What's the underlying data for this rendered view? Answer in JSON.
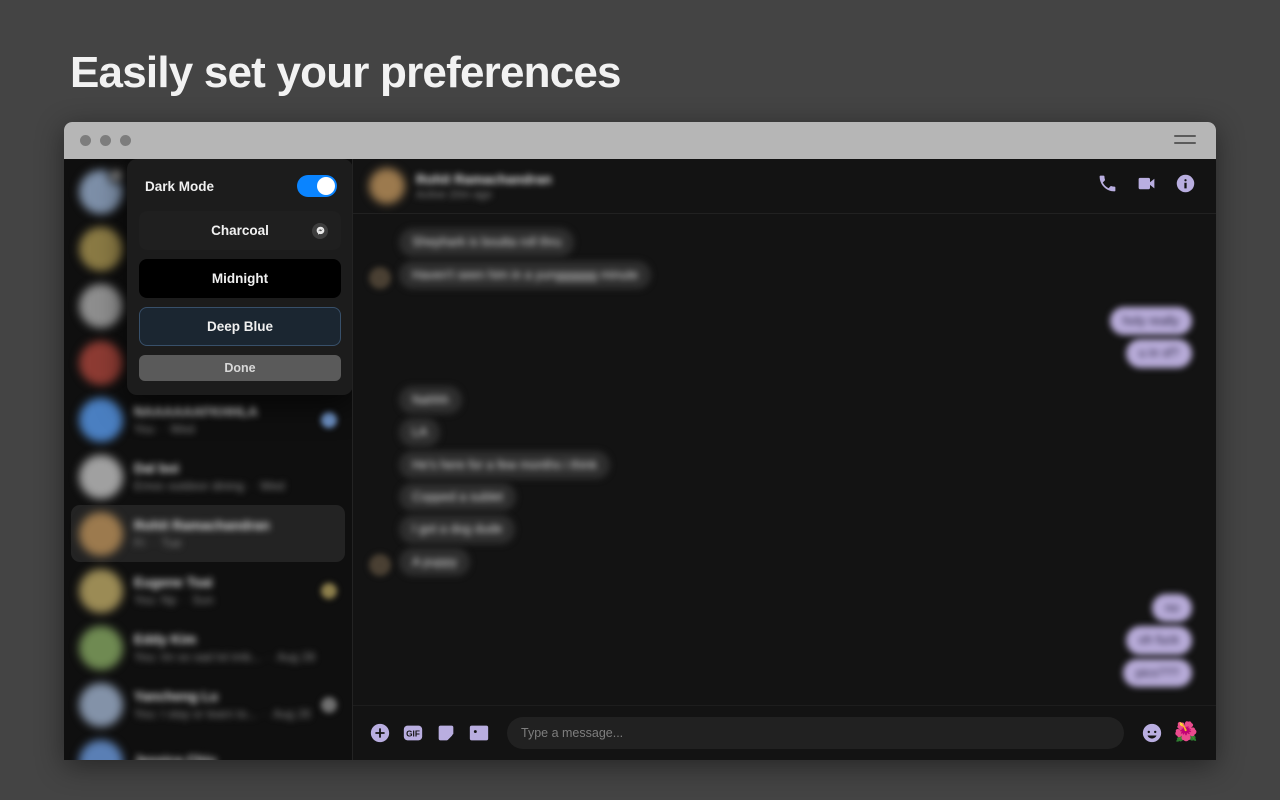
{
  "headline": "Easily set your preferences",
  "window": {
    "titlebar": {
      "dots": [
        "close-dot",
        "minimize-dot",
        "maximize-dot"
      ],
      "menu_icon": "hamburger-menu-icon"
    }
  },
  "dialog": {
    "title": "Dark Mode",
    "toggle": {
      "state": "on",
      "color": "#0a84ff"
    },
    "options": [
      {
        "label": "Charcoal",
        "selected": true,
        "swatch": "#1f1f1f",
        "badge_icon": "messenger-icon"
      },
      {
        "label": "Midnight",
        "selected": false,
        "swatch": "#000000"
      },
      {
        "label": "Deep Blue",
        "selected": false,
        "swatch": "#1b2631"
      }
    ],
    "done_label": "Done"
  },
  "sidebar": {
    "rows": [
      {
        "name": "",
        "snippet": "",
        "time": "",
        "avatar_tint": "#7d8fa8",
        "badge": "messenger-icon",
        "selected": false,
        "thumb": ""
      },
      {
        "name": "",
        "snippet": "",
        "time": "",
        "avatar_tint": "#8a7a44",
        "selected": false,
        "thumb": ""
      },
      {
        "name": "",
        "snippet": "",
        "time": "",
        "avatar_tint": "#8e8e8e",
        "selected": false,
        "thumb": ""
      },
      {
        "name": "",
        "snippet": "",
        "time": "",
        "avatar_tint": "#8d3b33",
        "selected": false,
        "thumb": ""
      },
      {
        "name": "NAAAAAAFKHHLA",
        "snippet": "You",
        "time": "Wed",
        "avatar_tint": "#4a7fc1",
        "selected": false,
        "thumb": "#6f93c7"
      },
      {
        "name": "Dal boi",
        "snippet": "Emoc outdoor dining",
        "time": "Wed",
        "avatar_tint": "#a0a0a0",
        "selected": false,
        "thumb": ""
      },
      {
        "name": "Rohit Ramachandran",
        "snippet": "Fr",
        "time": "Tue",
        "avatar_tint": "#9c7a4e",
        "selected": true,
        "thumb": ""
      },
      {
        "name": "Eugene Tsai",
        "snippet": "You: Np",
        "time": "Sun",
        "avatar_tint": "#9b8b55",
        "selected": false,
        "thumb": "#8d7f4c"
      },
      {
        "name": "Eddy Kim",
        "snippet": "You: Im so sad lol imb...",
        "time": "Aug 28",
        "avatar_tint": "#6f8a52",
        "selected": false,
        "thumb": ""
      },
      {
        "name": "Yancheng Lu",
        "snippet": "You: I stay or learn to...",
        "time": "Aug 26",
        "avatar_tint": "#8392a8",
        "selected": false,
        "thumb": "#707070"
      },
      {
        "name": "Jessica Chiu",
        "snippet": "",
        "time": "",
        "avatar_tint": "#5a7fb5",
        "selected": false,
        "thumb": ""
      }
    ]
  },
  "chat": {
    "header": {
      "name": "Rohit Ramachandran",
      "status": "Active 20m ago",
      "actions": [
        {
          "icon": "phone-icon",
          "label": "Voice call"
        },
        {
          "icon": "video-icon",
          "label": "Video call"
        },
        {
          "icon": "info-icon",
          "label": "Conversation info"
        }
      ]
    },
    "groups": [
      {
        "direction": "in",
        "messages": [
          "Shephark is boutta roll thru",
          "Haven't seen him in a yungggggg minute"
        ]
      },
      {
        "direction": "out",
        "messages": [
          "holy really",
          "u in sf?"
        ]
      },
      {
        "direction": "in",
        "messages": [
          "Nahhh",
          "LA",
          "He's here for a few months i think",
          "Copped a sublet",
          "I got a dog dude",
          "A puppy"
        ]
      },
      {
        "direction": "out",
        "messages": [
          "no",
          "oh fuck",
          "pics???"
        ]
      }
    ],
    "composer": {
      "placeholder": "Type a message...",
      "actions": [
        {
          "icon": "plus-circle-icon",
          "label": "Add"
        },
        {
          "icon": "gif-icon",
          "label": "GIF"
        },
        {
          "icon": "sticker-icon",
          "label": "Sticker"
        },
        {
          "icon": "photo-icon",
          "label": "Photo"
        }
      ],
      "emoji_button": "smiley-icon",
      "quick_emoji": "🌺"
    }
  }
}
